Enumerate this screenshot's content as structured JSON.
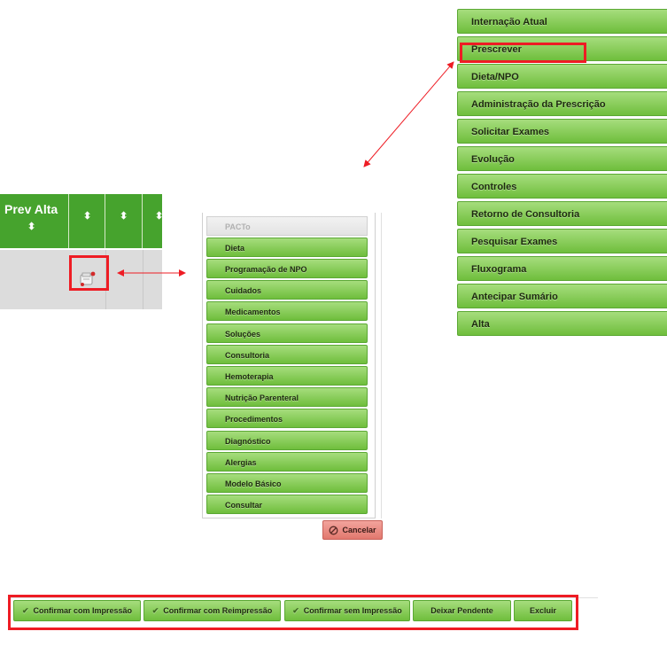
{
  "right_menu": {
    "items": [
      {
        "label": "Internação Atual"
      },
      {
        "label": "Prescrever"
      },
      {
        "label": "Dieta/NPO"
      },
      {
        "label": "Administração da Prescrição"
      },
      {
        "label": "Solicitar Exames"
      },
      {
        "label": "Evolução"
      },
      {
        "label": "Controles"
      },
      {
        "label": "Retorno de Consultoria"
      },
      {
        "label": "Pesquisar Exames"
      },
      {
        "label": "Fluxograma"
      },
      {
        "label": "Antecipar Sumário"
      },
      {
        "label": "Alta"
      }
    ]
  },
  "table": {
    "header_prev_alta": "Prev Alta",
    "sort_icon": "sort-up-down-icon"
  },
  "mid_menu": {
    "header": "PACTo",
    "items": [
      {
        "label": "Dieta"
      },
      {
        "label": "Programação de NPO"
      },
      {
        "label": "Cuidados"
      },
      {
        "label": "Medicamentos"
      },
      {
        "label": "Soluções"
      },
      {
        "label": "Consultoria"
      },
      {
        "label": "Hemoterapia"
      },
      {
        "label": "Nutrição Parenteral"
      },
      {
        "label": "Procedimentos"
      },
      {
        "label": "Diagnóstico"
      },
      {
        "label": "Alergias"
      },
      {
        "label": "Modelo Básico"
      },
      {
        "label": "Consultar"
      }
    ],
    "cancel_label": "Cancelar"
  },
  "bottom_bar": {
    "confirm_print": "Confirmar com Impressão",
    "confirm_reprint": "Confirmar com Reimpressão",
    "confirm_no_print": "Confirmar sem Impressão",
    "leave_pending": "Deixar Pendente",
    "delete": "Excluir"
  },
  "colors": {
    "button_green_top": "#a6dd7d",
    "button_green_bottom": "#6fbe3c",
    "header_green": "#46a32d",
    "highlight_red": "#ee1c24",
    "cancel_red": "#e2786e"
  }
}
